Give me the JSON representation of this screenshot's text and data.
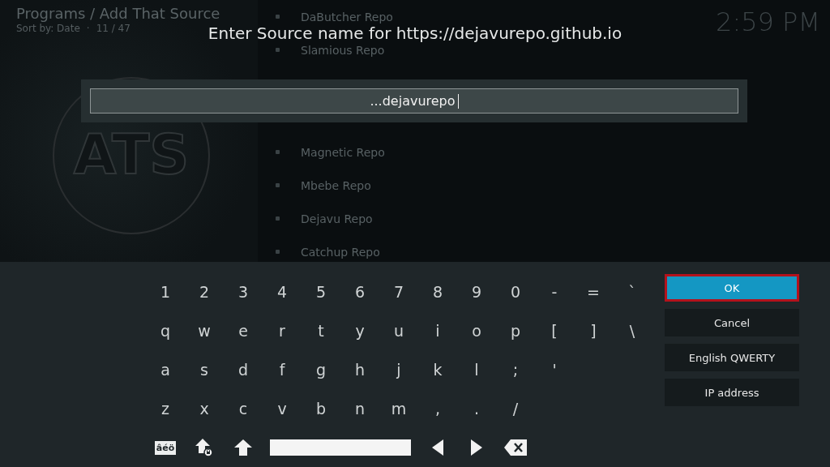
{
  "header": {
    "title": "Programs / Add That Source",
    "sort": "Sort by: Date",
    "separator": "·",
    "count": "11 / 47",
    "clock": "2:59 PM"
  },
  "logo": {
    "text": "ATS"
  },
  "list": [
    {
      "label": "DaButcher Repo"
    },
    {
      "label": "Slamious Repo"
    },
    {
      "label": "Magnetic Repo"
    },
    {
      "label": "Mbebe Repo"
    },
    {
      "label": "Dejavu Repo"
    },
    {
      "label": "Catchup Repo"
    }
  ],
  "dialog": {
    "title": "Enter Source name for https://dejavurepo.github.io",
    "value": "...dejavurepo"
  },
  "keyboard": {
    "rows": [
      [
        "1",
        "2",
        "3",
        "4",
        "5",
        "6",
        "7",
        "8",
        "9",
        "0",
        "-",
        "=",
        "`"
      ],
      [
        "q",
        "w",
        "e",
        "r",
        "t",
        "y",
        "u",
        "i",
        "o",
        "p",
        "[",
        "]",
        "\\"
      ],
      [
        "a",
        "s",
        "d",
        "f",
        "g",
        "h",
        "j",
        "k",
        "l",
        ";",
        "'"
      ],
      [
        "z",
        "x",
        "c",
        "v",
        "b",
        "n",
        "m",
        ",",
        ".",
        "/"
      ]
    ],
    "special_keys": [
      {
        "kind": "accents",
        "label": "âéö"
      },
      {
        "kind": "capslock"
      },
      {
        "kind": "shift"
      },
      {
        "kind": "space"
      },
      {
        "kind": "left"
      },
      {
        "kind": "right"
      },
      {
        "kind": "backspace"
      }
    ]
  },
  "buttons": [
    {
      "label": "OK",
      "selected": true
    },
    {
      "label": "Cancel",
      "selected": false
    },
    {
      "label": "English QWERTY",
      "selected": false
    },
    {
      "label": "IP address",
      "selected": false
    }
  ]
}
